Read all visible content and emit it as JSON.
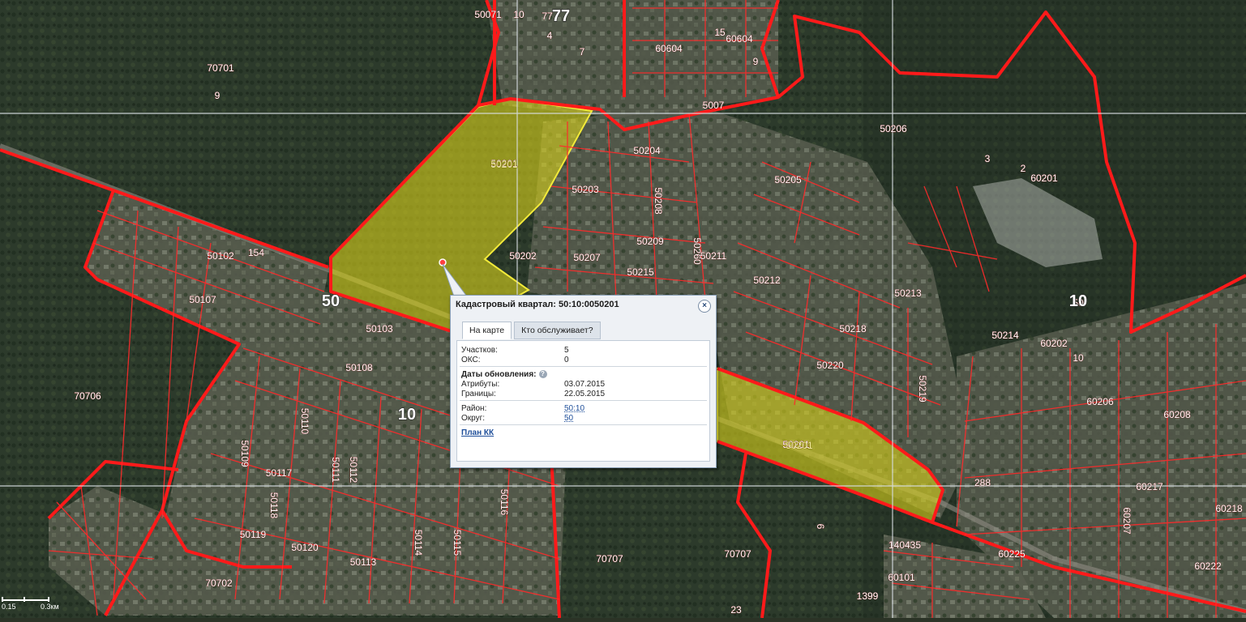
{
  "map": {
    "parcel_labels": [
      "50071",
      "10",
      "77",
      "4",
      "7",
      "15",
      "60604",
      "60604",
      "9",
      "5007",
      "70701",
      "9",
      "50206",
      "50201",
      "50204",
      "50203",
      "50208",
      "50209",
      "50202",
      "50207",
      "50215",
      "50260",
      "50211",
      "50205",
      "50212",
      "60201",
      "3",
      "2",
      "50102",
      "154",
      "50107",
      "50103",
      "50108",
      "70706",
      "50110",
      "50109",
      "50117",
      "50111",
      "50112",
      "50118",
      "50119",
      "50120",
      "50113",
      "50114",
      "50115",
      "50116",
      "70707",
      "70702",
      "70707",
      "6",
      "50218",
      "50220",
      "50219",
      "50214",
      "50213",
      "50201",
      "60202",
      "10",
      "60206",
      "60208",
      "60217",
      "60218",
      "60225",
      "60207",
      "60222",
      "288",
      "140435",
      "60101",
      "1399",
      "23",
      "50"
    ],
    "big_labels": [
      "50",
      "10",
      "50",
      "10",
      "77"
    ],
    "highlight_label_1": "50201",
    "highlight_label_2": "50201"
  },
  "popup": {
    "title": "Кадастровый квартал: 50:10:0050201",
    "close_glyph": "×",
    "tabs": [
      "На карте",
      "Кто обслуживает?"
    ],
    "rows": {
      "parcels_label": "Участков:",
      "parcels_value": "5",
      "oks_label": "ОКС:",
      "oks_value": "0",
      "update_dates_label": "Даты обновления:",
      "help_glyph": "?",
      "attributes_label": "Атрибуты:",
      "attributes_value": "03.07.2015",
      "borders_label": "Границы:",
      "borders_value": "22.05.2015",
      "district_label": "Район:",
      "district_value": "50:10",
      "okrug_label": "Округ:",
      "okrug_value": "50",
      "plan_link": "План КК"
    }
  },
  "scale": {
    "left_label": "0.15",
    "right_label": "0.3км"
  },
  "colors": {
    "boundary": "#ff1a1a",
    "highlight_fill": "#d8d21a",
    "forest": "#2e3a2c",
    "grid": "#d8dde3"
  },
  "icons": {
    "close": "close-icon",
    "help": "help-icon",
    "marker": "location-marker-icon"
  }
}
